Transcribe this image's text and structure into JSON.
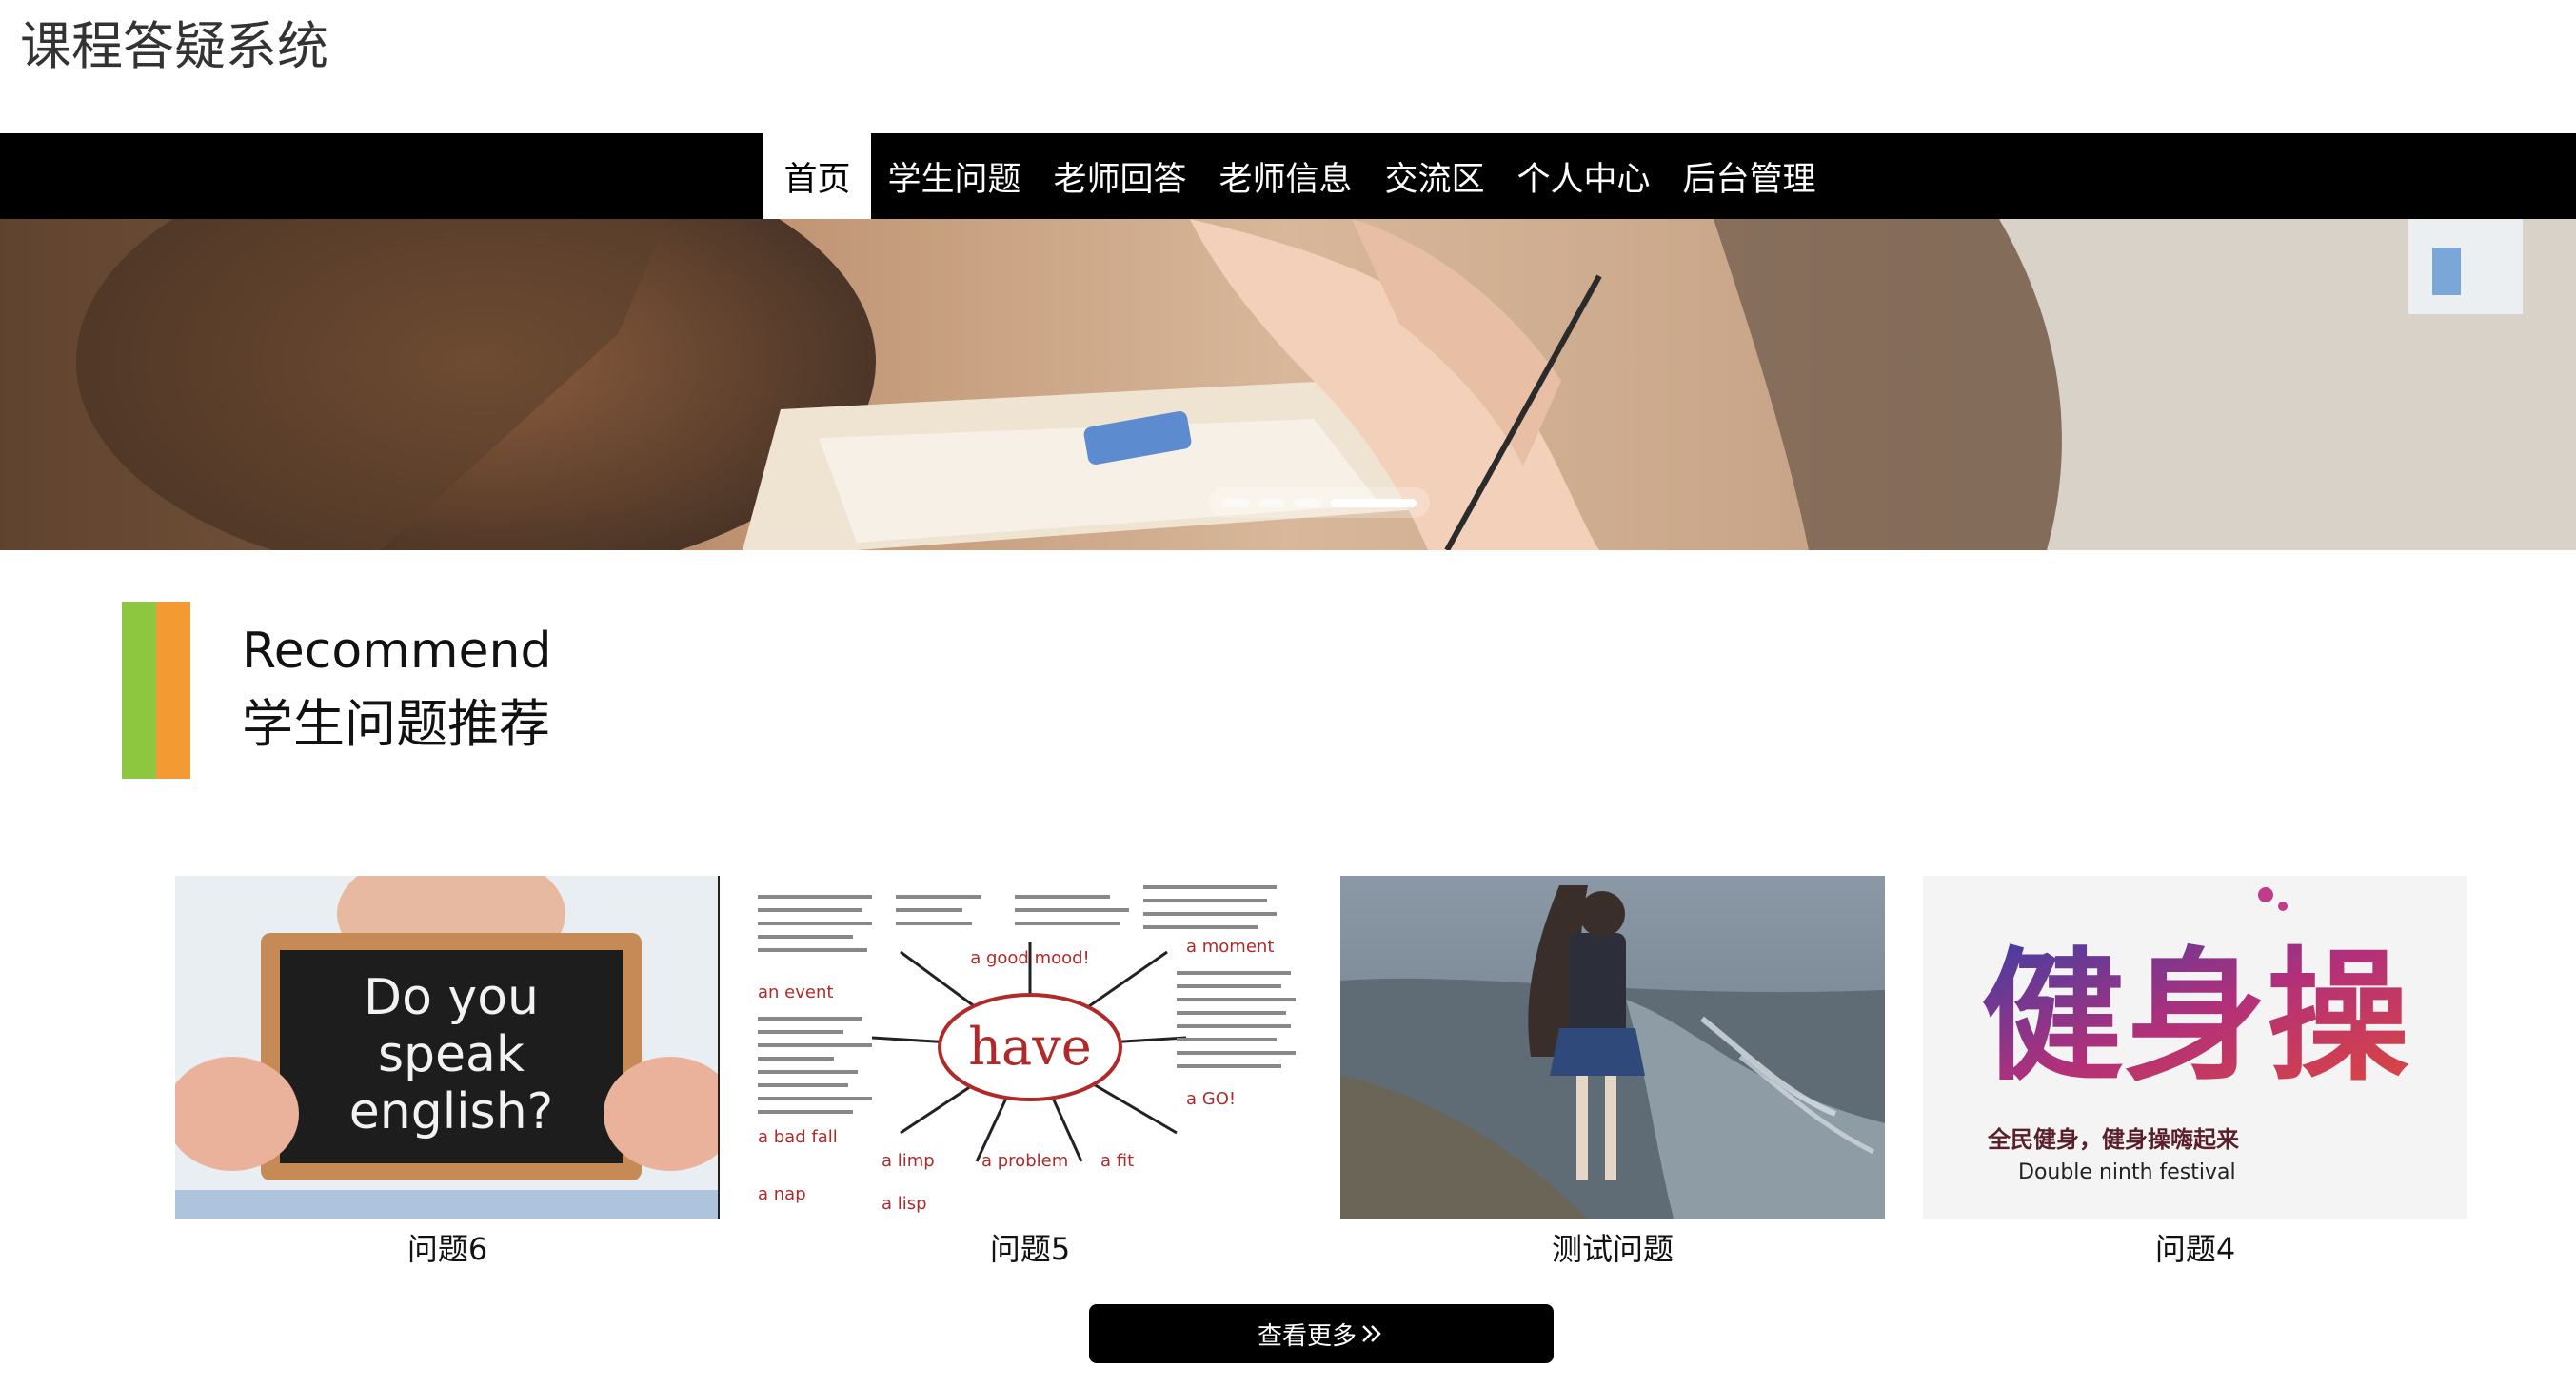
{
  "site": {
    "title": "课程答疑系统"
  },
  "nav": {
    "items": [
      {
        "label": "首页",
        "active": true
      },
      {
        "label": "学生问题",
        "active": false
      },
      {
        "label": "老师回答",
        "active": false
      },
      {
        "label": "老师信息",
        "active": false
      },
      {
        "label": "交流区",
        "active": false
      },
      {
        "label": "个人中心",
        "active": false
      },
      {
        "label": "后台管理",
        "active": false
      }
    ]
  },
  "banner": {
    "slides": 4,
    "active_slide": 4
  },
  "section": {
    "title_en": "Recommend",
    "title_cn": "学生问题推荐",
    "marker_colors": [
      "#8dc63f",
      "#f39a33"
    ]
  },
  "cards": [
    {
      "caption": "问题6",
      "image_text": [
        "Do you",
        "speak",
        "english?"
      ]
    },
    {
      "caption": "问题5",
      "image_text": [
        "have",
        "a good mood!",
        "an event",
        "a moment",
        "a bad fall",
        "a limp",
        "a problem",
        "a fit",
        "a nap",
        "a lisp",
        "a GO!"
      ]
    },
    {
      "caption": "测试问题"
    },
    {
      "caption": "问题4",
      "image_text": [
        "健身操",
        "全民健身，健身操嗨起来",
        "Double ninth festival"
      ]
    }
  ],
  "more_button": {
    "label": "查看更多",
    "icon": "double-chevron-right-icon"
  }
}
